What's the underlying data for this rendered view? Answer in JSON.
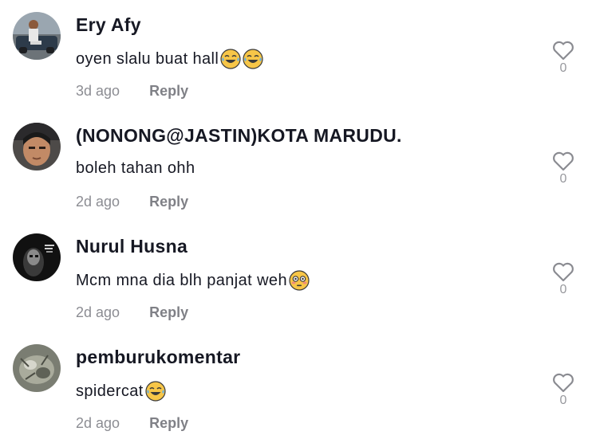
{
  "comments": [
    {
      "username": "Ery Afy",
      "text": "oyen slalu buat hall",
      "emojis": [
        "tears-of-joy",
        "tears-of-joy"
      ],
      "time": "3d ago",
      "reply_label": "Reply",
      "likes": "0"
    },
    {
      "username": "(NONONG@JASTIN)KOTA MARUDU.",
      "text": "boleh tahan ohh",
      "emojis": [],
      "time": "2d ago",
      "reply_label": "Reply",
      "likes": "0"
    },
    {
      "username": "Nurul Husna",
      "text": "Mcm mna dia blh panjat weh ",
      "emojis": [
        "flushed-face"
      ],
      "time": "2d ago",
      "reply_label": "Reply",
      "likes": "0"
    },
    {
      "username": "pemburukomentar",
      "text": "spidercat ",
      "emojis": [
        "tears-of-joy"
      ],
      "time": "2d ago",
      "reply_label": "Reply",
      "likes": "0"
    }
  ],
  "colors": {
    "text_primary": "#161823",
    "text_secondary": "#8a8b91",
    "emoji_yellow": "#f7c648"
  }
}
